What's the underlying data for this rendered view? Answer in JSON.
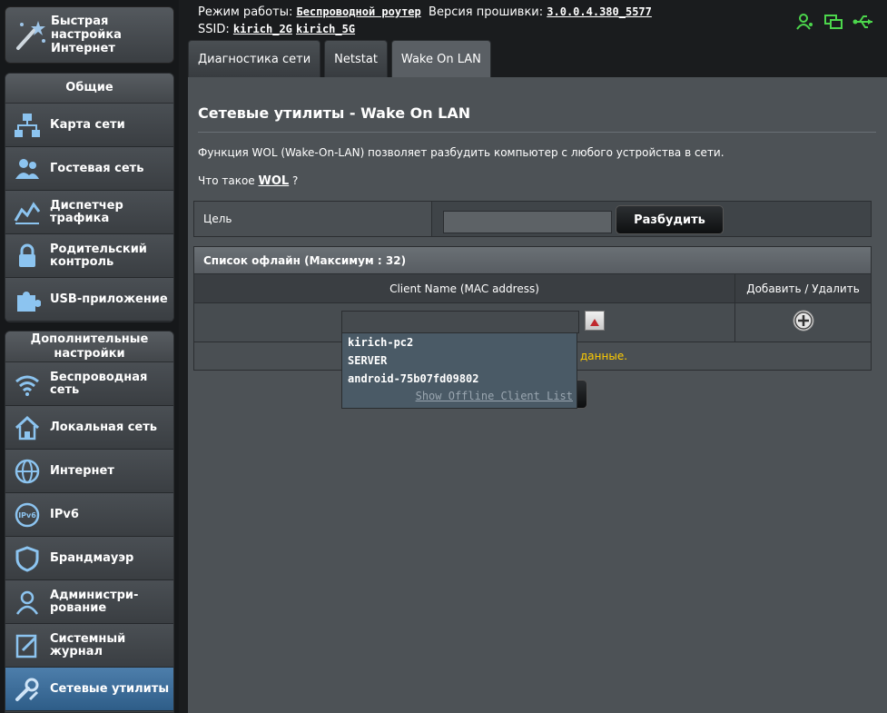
{
  "sidebar": {
    "quick_setup": "Быстрая настройка Интернет",
    "general_header": "Общие",
    "general_items": [
      {
        "label": "Карта сети",
        "icon": "network-map-icon"
      },
      {
        "label": "Гостевая сеть",
        "icon": "guest-network-icon"
      },
      {
        "label": "Диспетчер трафика",
        "icon": "traffic-manager-icon"
      },
      {
        "label": "Родительский контроль",
        "icon": "lock-icon"
      },
      {
        "label": "USB-приложение",
        "icon": "puzzle-icon"
      }
    ],
    "advanced_header": "Дополнительные настройки",
    "advanced_items": [
      {
        "label": "Беспроводная сеть",
        "icon": "wifi-icon"
      },
      {
        "label": "Локальная сеть",
        "icon": "home-icon"
      },
      {
        "label": "Интернет",
        "icon": "globe-icon"
      },
      {
        "label": "IPv6",
        "icon": "ipv6-icon"
      },
      {
        "label": "Брандмауэр",
        "icon": "shield-icon"
      },
      {
        "label": "Администри-рование",
        "icon": "admin-icon"
      },
      {
        "label": "Системный журнал",
        "icon": "log-icon"
      },
      {
        "label": "Сетевые утилиты",
        "icon": "tools-icon"
      }
    ]
  },
  "topbar": {
    "mode_label": "Режим работы:",
    "mode_value": "Беспроводной роутер",
    "firmware_label": "Версия прошивки:",
    "firmware_value": "3.0.0.4.380_5577",
    "ssid_label": "SSID:",
    "ssid_2g": "kirich_2G",
    "ssid_5g": "kirich_5G"
  },
  "tabs": [
    {
      "label": "Диагностика сети"
    },
    {
      "label": "Netstat"
    },
    {
      "label": "Wake On LAN"
    }
  ],
  "main": {
    "title": "Сетевые утилиты - Wake On LAN",
    "description": "Функция WOL (Wake-On-LAN) позволяет разбудить компьютер с любого устройства в сети.",
    "whatis_prefix": "Что такое",
    "whatis_link": "WOL",
    "whatis_suffix": "?",
    "target_label": "Цель",
    "target_value": "",
    "wake_button": "Разбудить",
    "offline_header": "Список офлайн (Максимум : 32)",
    "col_client": "Client Name (MAC address)",
    "col_action": "Добавить / Удалить",
    "note_partial": "данные."
  },
  "dropdown": {
    "items": [
      "kirich-pc2",
      "SERVER",
      "android-75b07fd09802"
    ],
    "show_offline": "Show Offline Client List"
  },
  "colors": {
    "active_menu": "#3a6a96",
    "note": "#ffcc00",
    "status_icon": "#4cd64c"
  }
}
